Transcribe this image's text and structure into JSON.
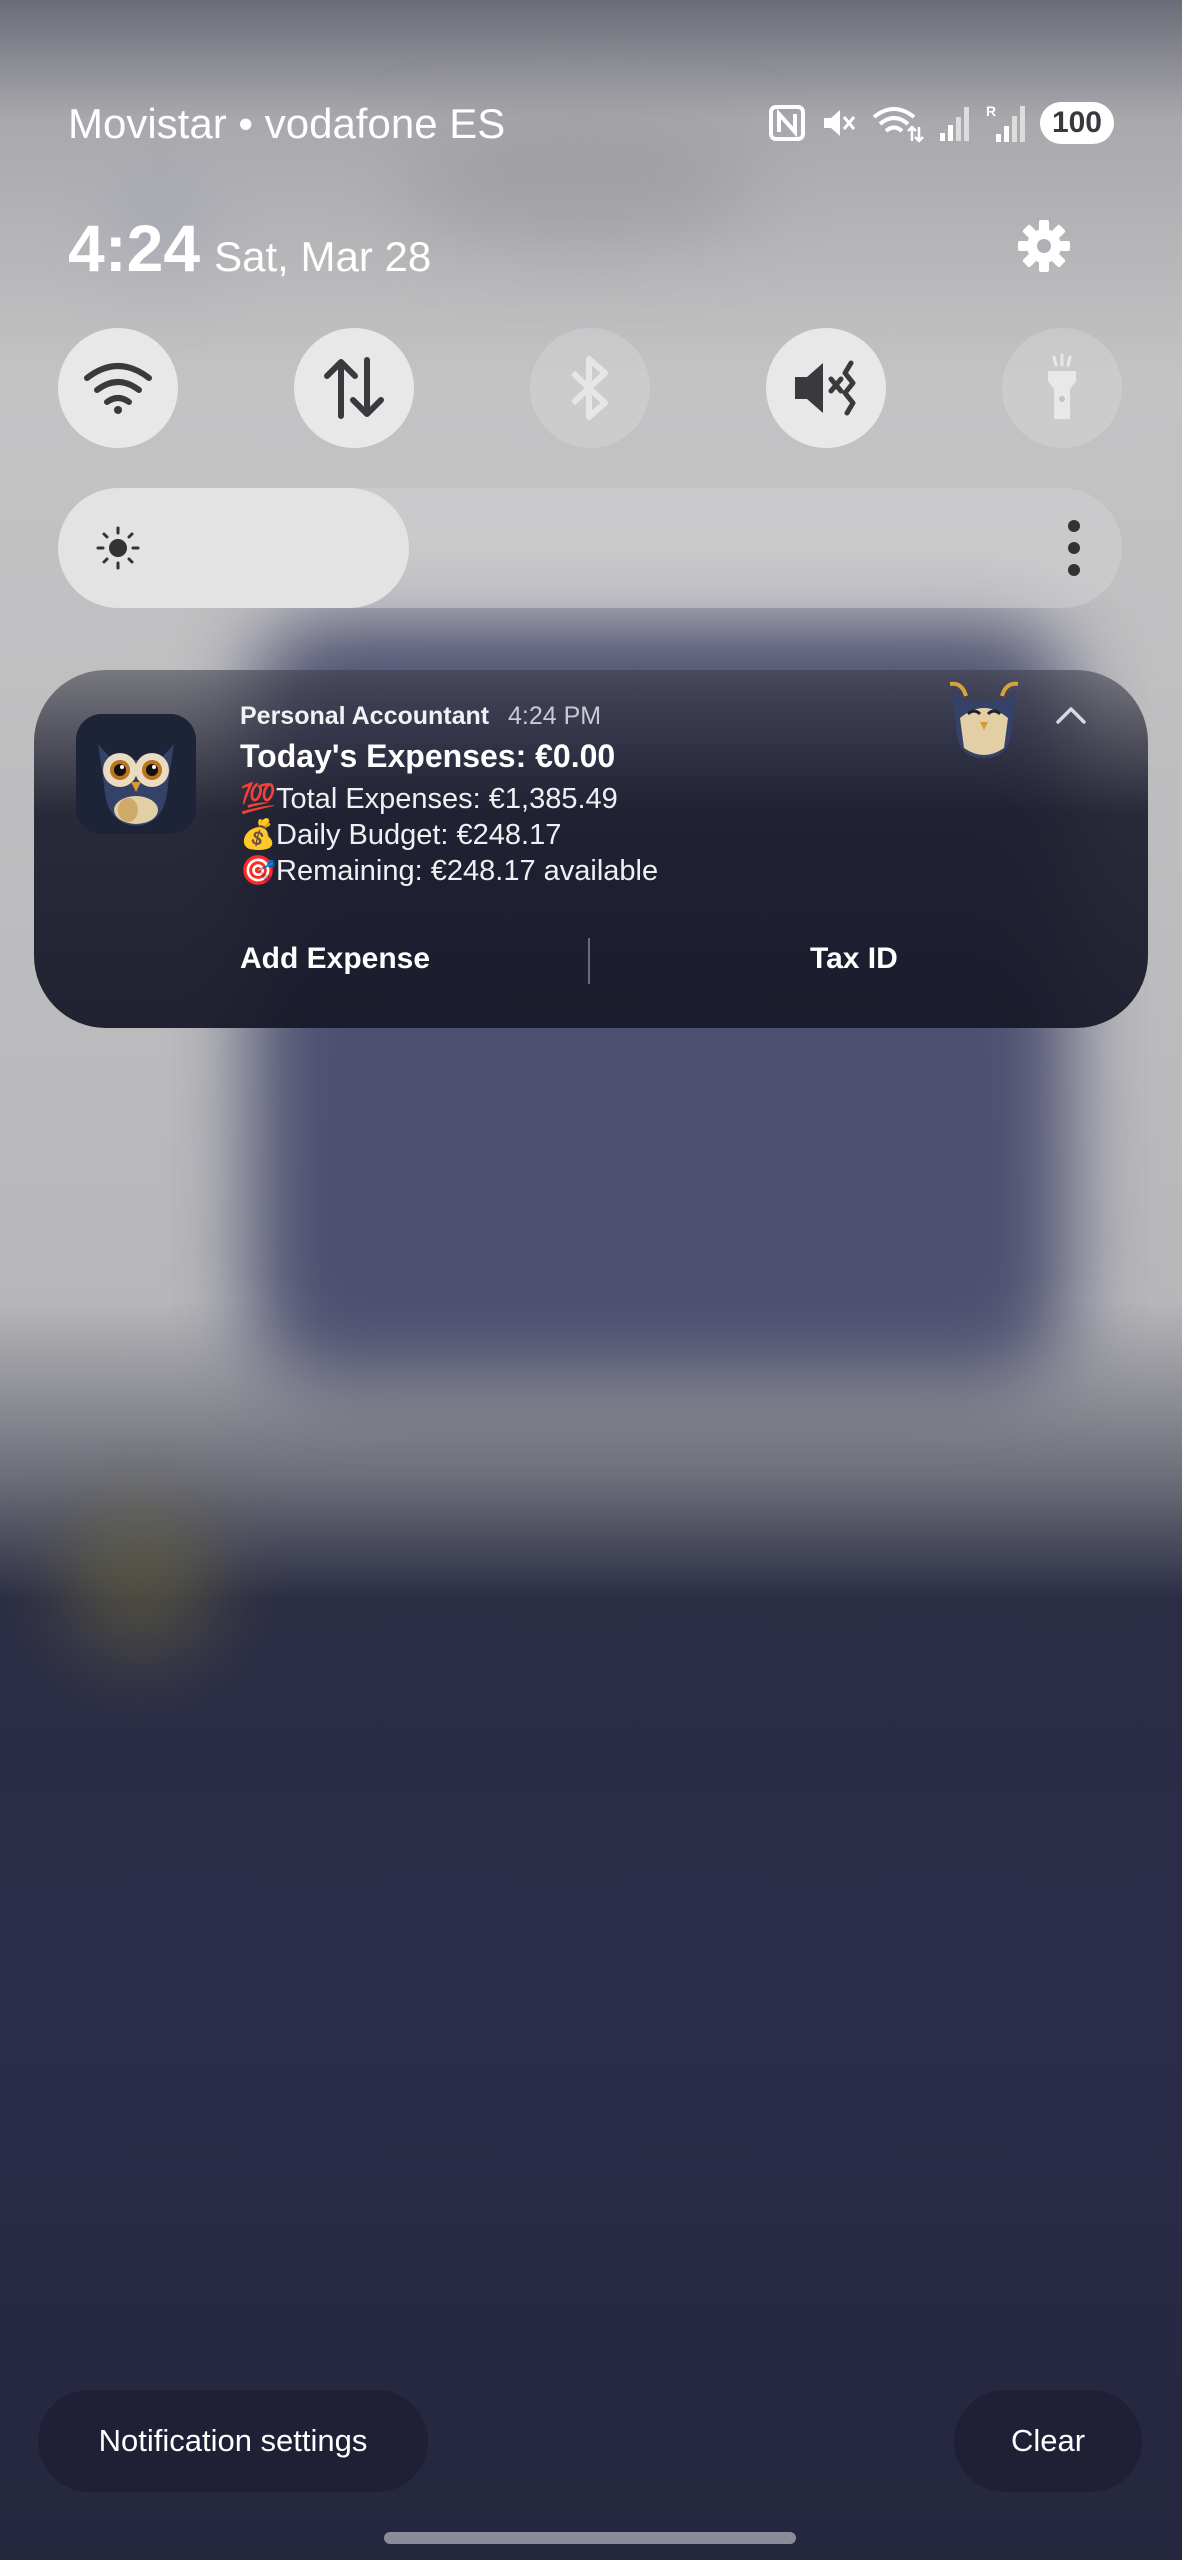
{
  "status": {
    "carrier": "Movistar • vodafone ES",
    "battery": "100",
    "icons": [
      "nfc-icon",
      "mute-icon",
      "wifi-signal-icon",
      "cell-signal-icon",
      "cell-signal-roaming-icon"
    ]
  },
  "clock": {
    "time": "4:24",
    "date": "Sat, Mar 28"
  },
  "quick_settings": {
    "tiles": [
      {
        "name": "wifi",
        "state": "on",
        "icon": "wifi-icon"
      },
      {
        "name": "mobile-data",
        "state": "on",
        "icon": "data-arrows-icon"
      },
      {
        "name": "bluetooth",
        "state": "off",
        "icon": "bluetooth-icon"
      },
      {
        "name": "sound",
        "state": "on",
        "icon": "mute-icon"
      },
      {
        "name": "flashlight",
        "state": "off",
        "icon": "flashlight-icon"
      }
    ],
    "brightness_fraction": 0.33
  },
  "notification": {
    "app": "Personal Accountant",
    "time": "4:24 PM",
    "title": "Today's Expenses: €0.00",
    "lines": [
      {
        "emoji": "💯",
        "text": "Total Expenses: €1,385.49"
      },
      {
        "emoji": "💰",
        "text": "Daily Budget: €248.17"
      },
      {
        "emoji": "🎯",
        "text": "Remaining: €248.17 available"
      }
    ],
    "actions": [
      "Add Expense",
      "Tax ID"
    ]
  },
  "footer": {
    "settings_label": "Notification settings",
    "clear_label": "Clear"
  },
  "colors": {
    "card_bg": "#1c1e2e",
    "pill_bg": "#1f2035",
    "tile_on": "#ebebec"
  }
}
